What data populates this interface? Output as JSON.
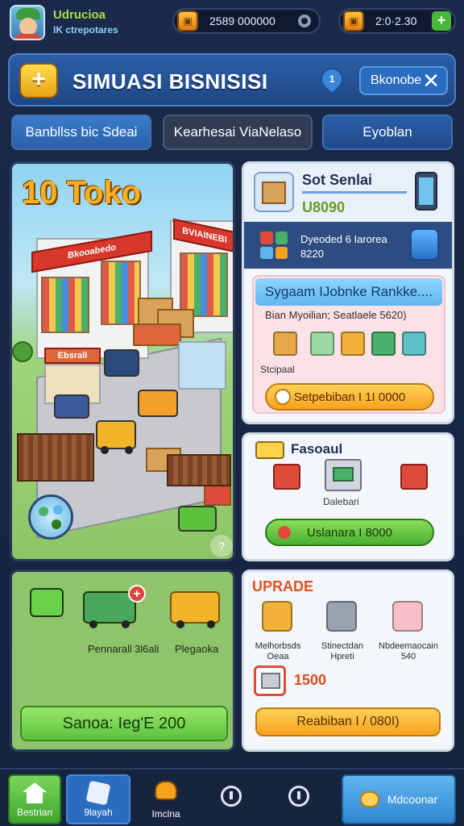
{
  "player": {
    "name": "Udrucioa",
    "subtitle": "IK ctrepotares"
  },
  "resources": [
    {
      "icon": "gold-crate-icon",
      "value": "2589 000000"
    },
    {
      "icon": "gold-crate-icon",
      "value": "2:0·2.30"
    }
  ],
  "header": {
    "badge": "+",
    "title": "SIMUASI BISNISISI",
    "pin_label": "1",
    "button_label": "Bkonobe",
    "close": "✕"
  },
  "tabs": [
    {
      "label": "Banbllss bic Sdeai",
      "active": true
    },
    {
      "label": "Kearhesai ViaNelaso",
      "active": false
    },
    {
      "label": "Eyoblan",
      "active": false
    }
  ],
  "shop": {
    "title": "10 Toko",
    "signs": [
      "Bkooabedo",
      "BVIAINEBI",
      "Ebsrall"
    ],
    "help": "?"
  },
  "stock_card": {
    "title": "Sot Senlai",
    "value": "U8090",
    "band_title": "Dyeoded 6 Iarorea",
    "band_value": "8220",
    "offer_title": "Sygaam IJobnke Rankke....",
    "offer_sub": "Bian Myoilian; Seatlaele 5620)",
    "items_label": "Stcipaal",
    "offer_button": "Setpebiban I 1I 0000"
  },
  "gift_card": {
    "title": "Fasoaul",
    "item_label": "Dalebari",
    "button": "Uslanara I 8000"
  },
  "vehicles": {
    "labels": [
      "Pennarall",
      "3l6ali",
      "Plegaoka"
    ],
    "button": "Sanoa: Ieg'E 200"
  },
  "upgrade": {
    "title": "UPRADE",
    "items": [
      {
        "label": "Melhorbsds Oeaa"
      },
      {
        "label": "Stinectdan Hpreti"
      },
      {
        "label": "Nbdeemaocain 540"
      }
    ],
    "price": "1500",
    "button": "Reabiban I / 080I)"
  },
  "nav": [
    {
      "label": "Bestrian",
      "icon": "home-icon"
    },
    {
      "label": "9layah",
      "icon": "map-icon"
    },
    {
      "label": "Imclna",
      "icon": "inventory-icon"
    },
    {
      "label": "",
      "icon": "clock-icon"
    },
    {
      "label": "",
      "icon": "download-icon"
    },
    {
      "label": "Mdcoonar",
      "icon": "chat-icon"
    }
  ],
  "colors": {
    "accent_green": "#4ab032",
    "accent_orange": "#f5a21e",
    "header_blue": "#2c5fa8",
    "shop_title": "#f6b11e"
  }
}
